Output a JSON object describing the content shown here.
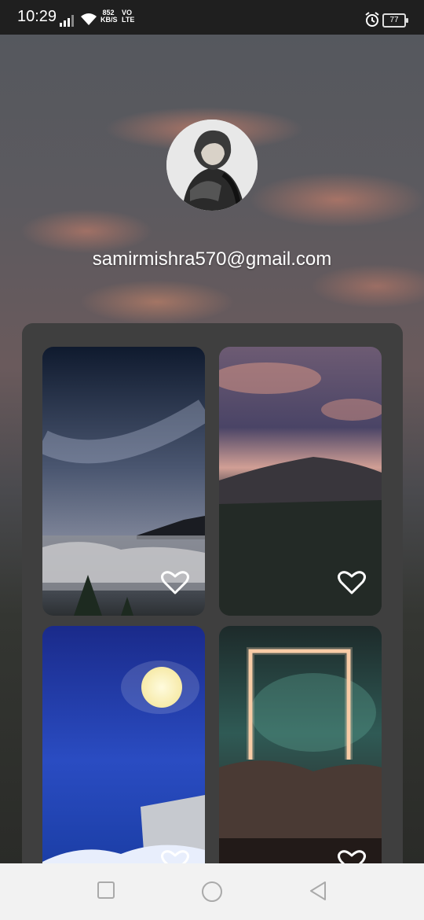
{
  "status": {
    "time": "10:29",
    "net_speed_value": "852",
    "net_speed_unit": "KB/S",
    "volte_top": "VO",
    "volte_bottom": "LTE",
    "battery": "77"
  },
  "profile": {
    "email": "samirmishra570@gmail.com"
  },
  "wallpapers": [
    {
      "title": "starry sky over clouds",
      "favorite": false
    },
    {
      "title": "mountain forest at dusk",
      "favorite": false
    },
    {
      "title": "ship under full moon",
      "favorite": false
    },
    {
      "title": "neon portal in nebula",
      "favorite": false
    }
  ],
  "icons": {
    "favorite": "heart-outline-icon",
    "recent": "square-icon",
    "home": "circle-icon",
    "back": "triangle-back-icon"
  }
}
